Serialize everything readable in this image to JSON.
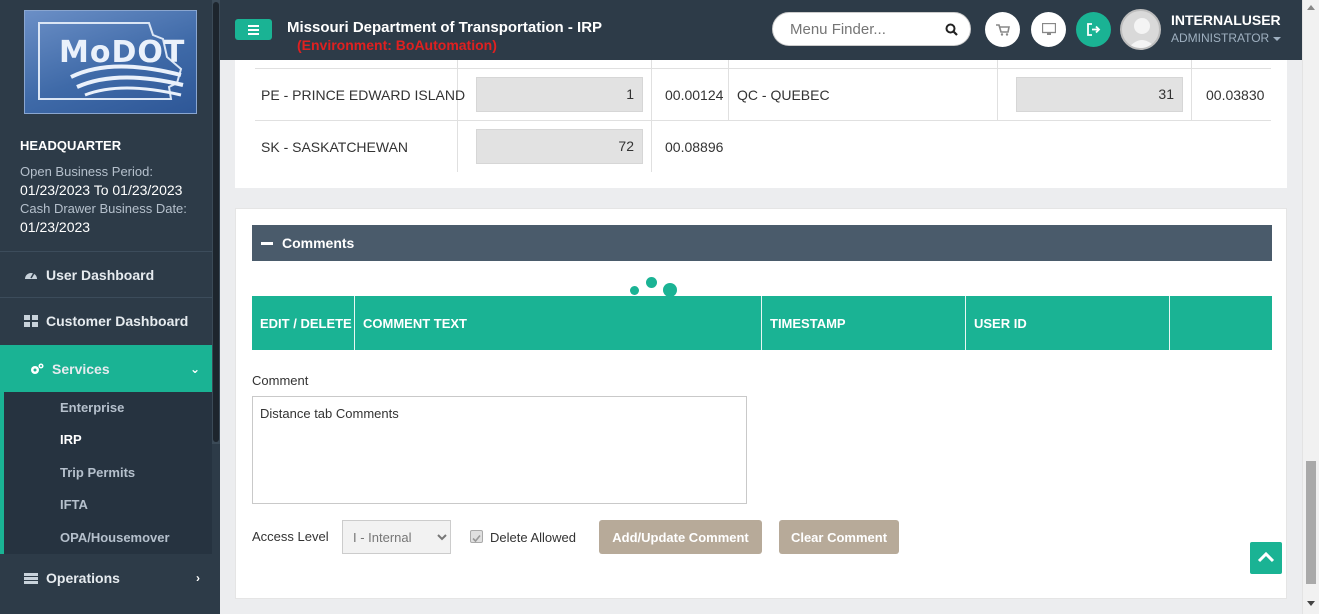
{
  "sidebar": {
    "logo_text": "MoDOT",
    "office": "HEADQUARTER",
    "open_business_period_label": "Open Business Period:",
    "open_business_period_value": "01/23/2023 To 01/23/2023",
    "cash_drawer_label": "Cash Drawer Business Date:",
    "cash_drawer_value": "01/23/2023",
    "items": [
      {
        "label": "User Dashboard",
        "icon": "dashboard-icon"
      },
      {
        "label": "Customer Dashboard",
        "icon": "grid-icon"
      },
      {
        "label": "Services",
        "icon": "gears-icon"
      },
      {
        "label": "Operations",
        "icon": "operations-icon"
      }
    ],
    "sub_items": [
      "Enterprise",
      "IRP",
      "Trip Permits",
      "IFTA",
      "OPA/Housemover"
    ]
  },
  "header": {
    "title": "Missouri Department of Transportation - IRP",
    "environment": "(Environment: BoAutomation)",
    "menu_finder_placeholder": "Menu Finder...",
    "user_name": "INTERNALUSER",
    "user_role": "ADMINISTRATOR",
    "icons": [
      "cart-icon",
      "monitor-icon",
      "logout-icon"
    ]
  },
  "distance_table": {
    "rows": [
      {
        "j1": "PE - PRINCE EDWARD ISLAND",
        "m1": "1",
        "p1": "00.00124",
        "j2": "QC - QUEBEC",
        "m2": "31",
        "p2": "00.03830"
      },
      {
        "j1": "SK - SASKATCHEWAN",
        "m1": "72",
        "p1": "00.08896"
      }
    ]
  },
  "comments": {
    "title": "Comments",
    "columns": [
      "EDIT / DELETE",
      "COMMENT TEXT",
      "TIMESTAMP",
      "USER ID",
      ""
    ],
    "comment_label": "Comment",
    "comment_value": "Distance tab Comments",
    "access_level_label": "Access Level",
    "access_level_value": "I - Internal",
    "delete_allowed_label": "Delete Allowed",
    "add_button": "Add/Update Comment",
    "clear_button": "Clear Comment"
  },
  "colors": {
    "accent": "#1ab394",
    "sidebar_bg": "#2d3b48",
    "section_header": "#4a5b6b",
    "button": "#b7aa99",
    "env_text": "#e02020"
  }
}
